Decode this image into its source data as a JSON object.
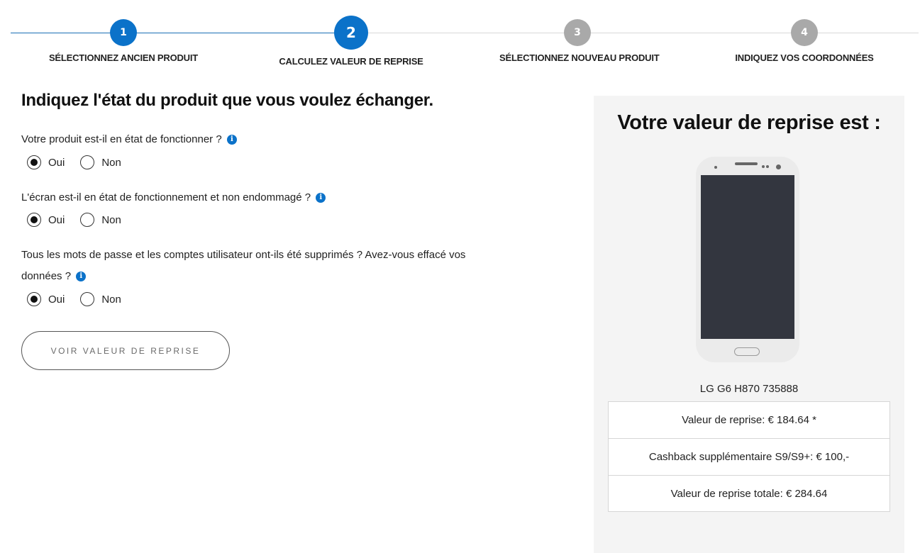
{
  "stepper": {
    "steps": [
      {
        "number": "1",
        "label": "SÉLECTIONNEZ ANCIEN PRODUIT",
        "state": "done"
      },
      {
        "number": "2",
        "label": "CALCULEZ VALEUR DE REPRISE",
        "state": "active"
      },
      {
        "number": "3",
        "label": "SÉLECTIONNEZ NOUVEAU PRODUIT",
        "state": "todo"
      },
      {
        "number": "4",
        "label": "INDIQUEZ VOS COORDONNÉES",
        "state": "todo"
      }
    ]
  },
  "form": {
    "heading": "Indiquez l'état du produit que vous voulez échanger.",
    "info_icon_glyph": "i",
    "questions": [
      {
        "text": "Votre produit est-il en état de fonctionner ?",
        "options": [
          "Oui",
          "Non"
        ],
        "selected": "Oui"
      },
      {
        "text": "L'écran est-il en état de fonctionnement et non endommagé ?",
        "options": [
          "Oui",
          "Non"
        ],
        "selected": "Oui"
      },
      {
        "text": "Tous les mots de passe et les comptes utilisateur ont-ils été supprimés ? Avez-vous effacé vos données ?",
        "options": [
          "Oui",
          "Non"
        ],
        "selected": "Oui"
      }
    ],
    "submit_label": "VOIR VALEUR DE REPRISE"
  },
  "summary": {
    "title": "Votre valeur de reprise est :",
    "model": "LG G6 H870 735888",
    "rows": [
      "Valeur de reprise: € 184.64 *",
      "Cashback supplémentaire S9/S9+: € 100,-",
      "Valeur de reprise totale: € 284.64"
    ]
  },
  "colors": {
    "accent": "#0b72c9",
    "inactive_step": "#a9a9a9",
    "panel_bg": "#f4f4f4"
  }
}
